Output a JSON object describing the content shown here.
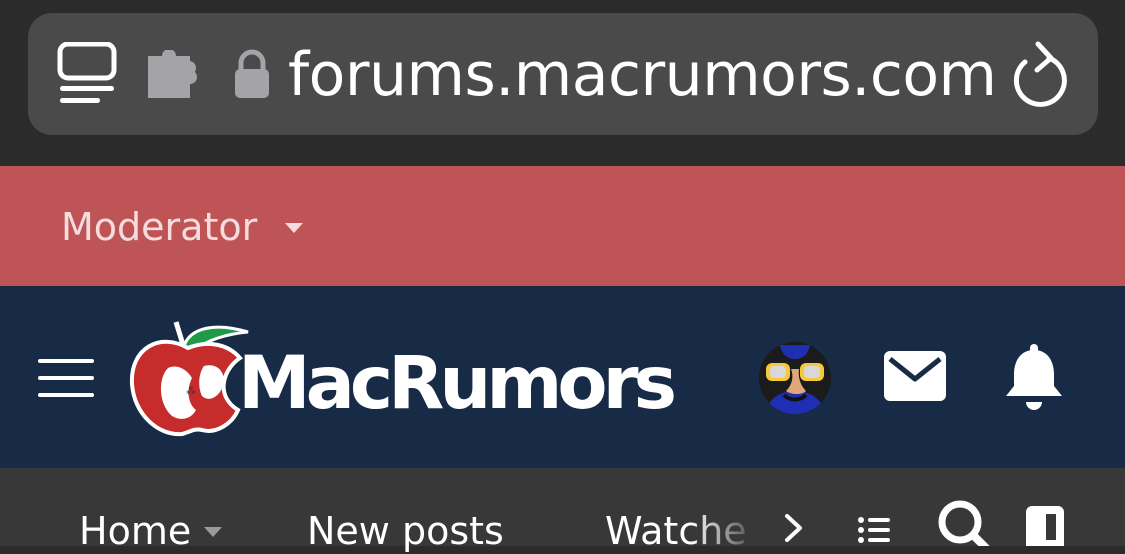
{
  "browser": {
    "url": "forums.macrumors.com",
    "icons": [
      "tabs-overview-icon",
      "extension-icon",
      "lock-icon",
      "reload-icon"
    ]
  },
  "moderator_bar": {
    "label": "Moderator",
    "icon": "caret-down-icon"
  },
  "site_header": {
    "brand": "MacRumors",
    "icons": [
      "hamburger-menu-icon",
      "macrumors-apple-logo",
      "user-avatar",
      "mail-icon",
      "bell-icon"
    ]
  },
  "nav": {
    "tabs": [
      {
        "label": "Home",
        "has_dropdown": true
      },
      {
        "label": "New posts"
      },
      {
        "label": "Watched"
      }
    ],
    "icons": [
      "chevron-right-icon",
      "list-icon",
      "search-icon",
      "sidebar-icon"
    ]
  },
  "colors": {
    "chrome_bg": "#2b2b2b",
    "address_pill": "#4a4a4a",
    "moderator_bar": "#bf5457",
    "header_bg": "#172b47",
    "nav_bg": "#383838"
  }
}
